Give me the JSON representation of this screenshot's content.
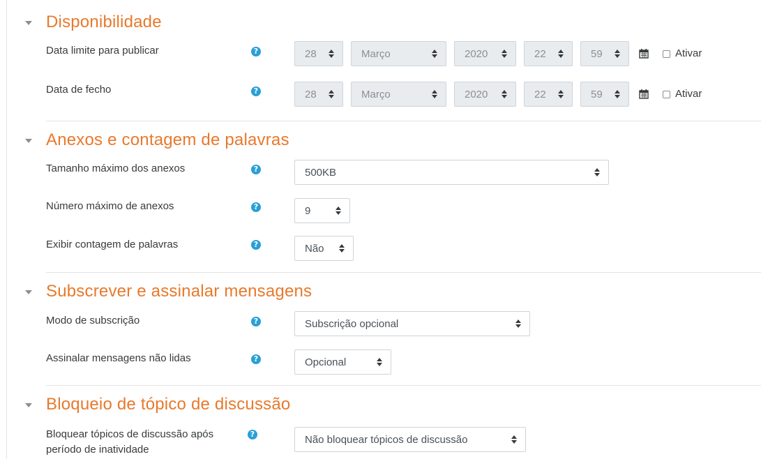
{
  "sections": {
    "availability": {
      "title": "Disponibilidade",
      "publish_deadline": {
        "label": "Data limite para publicar",
        "day": "28",
        "month": "Março",
        "year": "2020",
        "hour": "22",
        "minute": "59",
        "enable_label": "Ativar"
      },
      "close_date": {
        "label": "Data de fecho",
        "day": "28",
        "month": "Março",
        "year": "2020",
        "hour": "22",
        "minute": "59",
        "enable_label": "Ativar"
      }
    },
    "attachments": {
      "title": "Anexos e contagem de palavras",
      "max_size": {
        "label": "Tamanho máximo dos anexos",
        "value": "500KB"
      },
      "max_count": {
        "label": "Número máximo de anexos",
        "value": "9"
      },
      "word_count": {
        "label": "Exibir contagem de palavras",
        "value": "Não"
      }
    },
    "subscription": {
      "title": "Subscrever e assinalar mensagens",
      "mode": {
        "label": "Modo de subscrição",
        "value": "Subscrição opcional"
      },
      "tracking": {
        "label": "Assinalar mensagens não lidas",
        "value": "Opcional"
      }
    },
    "locking": {
      "title": "Bloqueio de tópico de discussão",
      "lock": {
        "label_line1": "Bloquear tópicos de discussão após",
        "label_line2": "período de inatividade",
        "value": "Não bloquear tópicos de discussão"
      }
    }
  },
  "icons": {
    "help": "question-circle-icon",
    "calendar": "calendar-icon",
    "collapse": "caret-down-icon"
  },
  "colors": {
    "section_title": "#e8792c",
    "help_icon": "#2a9fd6"
  }
}
